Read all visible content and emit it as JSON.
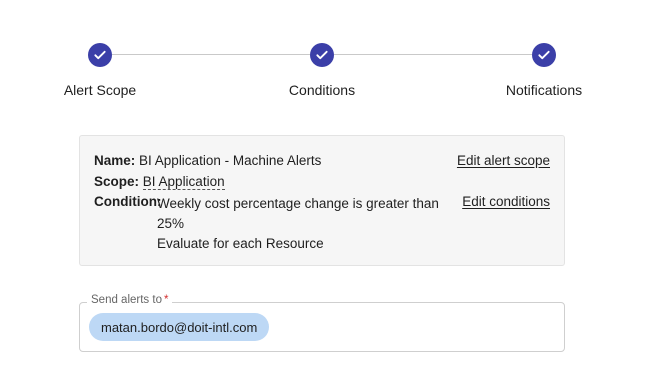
{
  "stepper": {
    "steps": [
      {
        "label": "Alert Scope",
        "icon": "check-icon",
        "completed": true
      },
      {
        "label": "Conditions",
        "icon": "check-icon",
        "completed": true
      },
      {
        "label": "Notifications",
        "icon": "check-icon",
        "completed": true
      }
    ],
    "accent_color": "#3b3fa8"
  },
  "summary": {
    "name_label": "Name:",
    "name_value": "BI Application - Machine Alerts",
    "scope_label": "Scope:",
    "scope_value": "BI Application",
    "condition_label": "Condition:",
    "condition_line1": "Weekly cost percentage change is greater than",
    "condition_line2": "25%",
    "condition_line3": "Evaluate for each Resource",
    "edit_scope_link": "Edit alert scope",
    "edit_conditions_link": "Edit conditions"
  },
  "send_alerts": {
    "label": "Send alerts to",
    "required_marker": "*",
    "recipients": [
      "matan.bordo@doit-intl.com"
    ],
    "chip_color": "#bdd8f5"
  }
}
